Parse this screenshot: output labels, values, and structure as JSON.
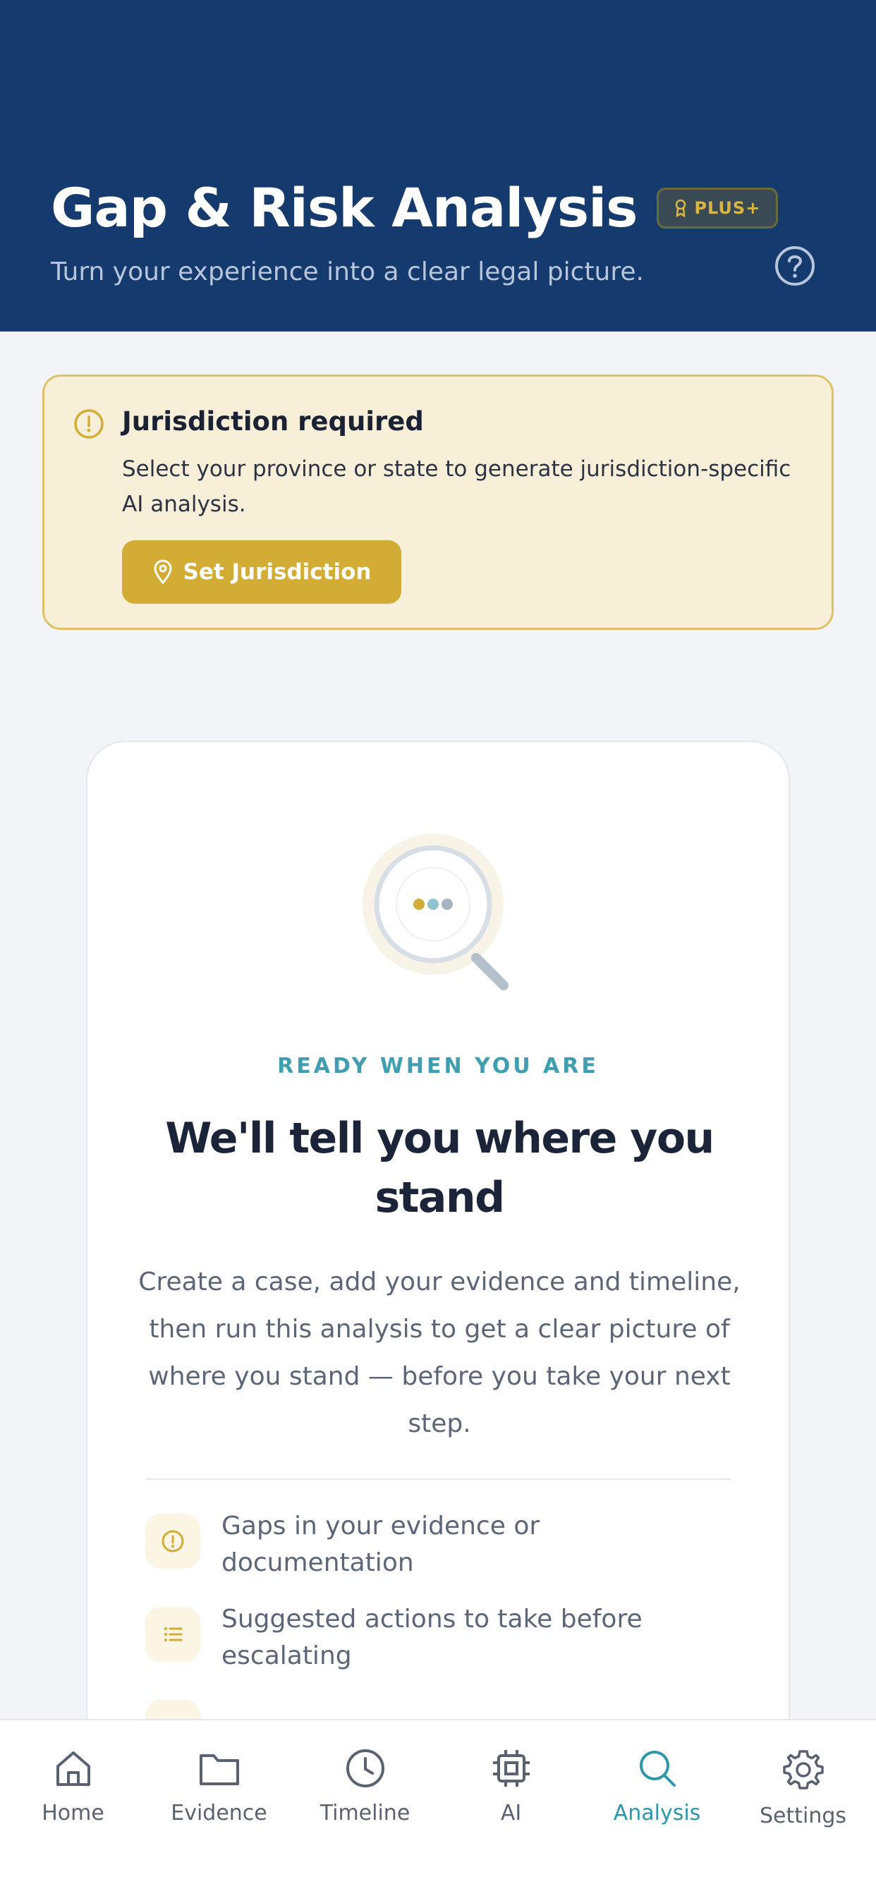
{
  "header": {
    "title": "Gap & Risk Analysis",
    "badge": "PLUS+",
    "subtitle": "Turn your experience into a clear legal picture.",
    "help_icon": "question-circle-icon"
  },
  "alert": {
    "title": "Jurisdiction required",
    "body": "Select your province or state to generate jurisdiction-specific AI analysis.",
    "button": "Set Jurisdiction",
    "icon": "warning-circle-icon"
  },
  "card": {
    "eyebrow": "READY WHEN YOU ARE",
    "heading": "We'll tell you where you stand",
    "description": "Create a case, add your evidence and timeline, then run this analysis to get a clear picture of where you stand — before you take your next step.",
    "features": [
      {
        "icon": "alert-circle-icon",
        "text": "Gaps in your evidence or documentation"
      },
      {
        "icon": "list-icon",
        "text": "Suggested actions to take before escalating"
      }
    ]
  },
  "tabs": [
    {
      "label": "Home",
      "icon": "home-icon"
    },
    {
      "label": "Evidence",
      "icon": "folder-icon"
    },
    {
      "label": "Timeline",
      "icon": "clock-icon"
    },
    {
      "label": "AI",
      "icon": "chip-icon"
    },
    {
      "label": "Analysis",
      "icon": "search-icon",
      "active": true
    },
    {
      "label": "Settings",
      "icon": "gear-icon"
    }
  ],
  "colors": {
    "header_bg": "#153a6e",
    "accent_gold": "#d2ac34",
    "accent_teal": "#2e97ad"
  }
}
